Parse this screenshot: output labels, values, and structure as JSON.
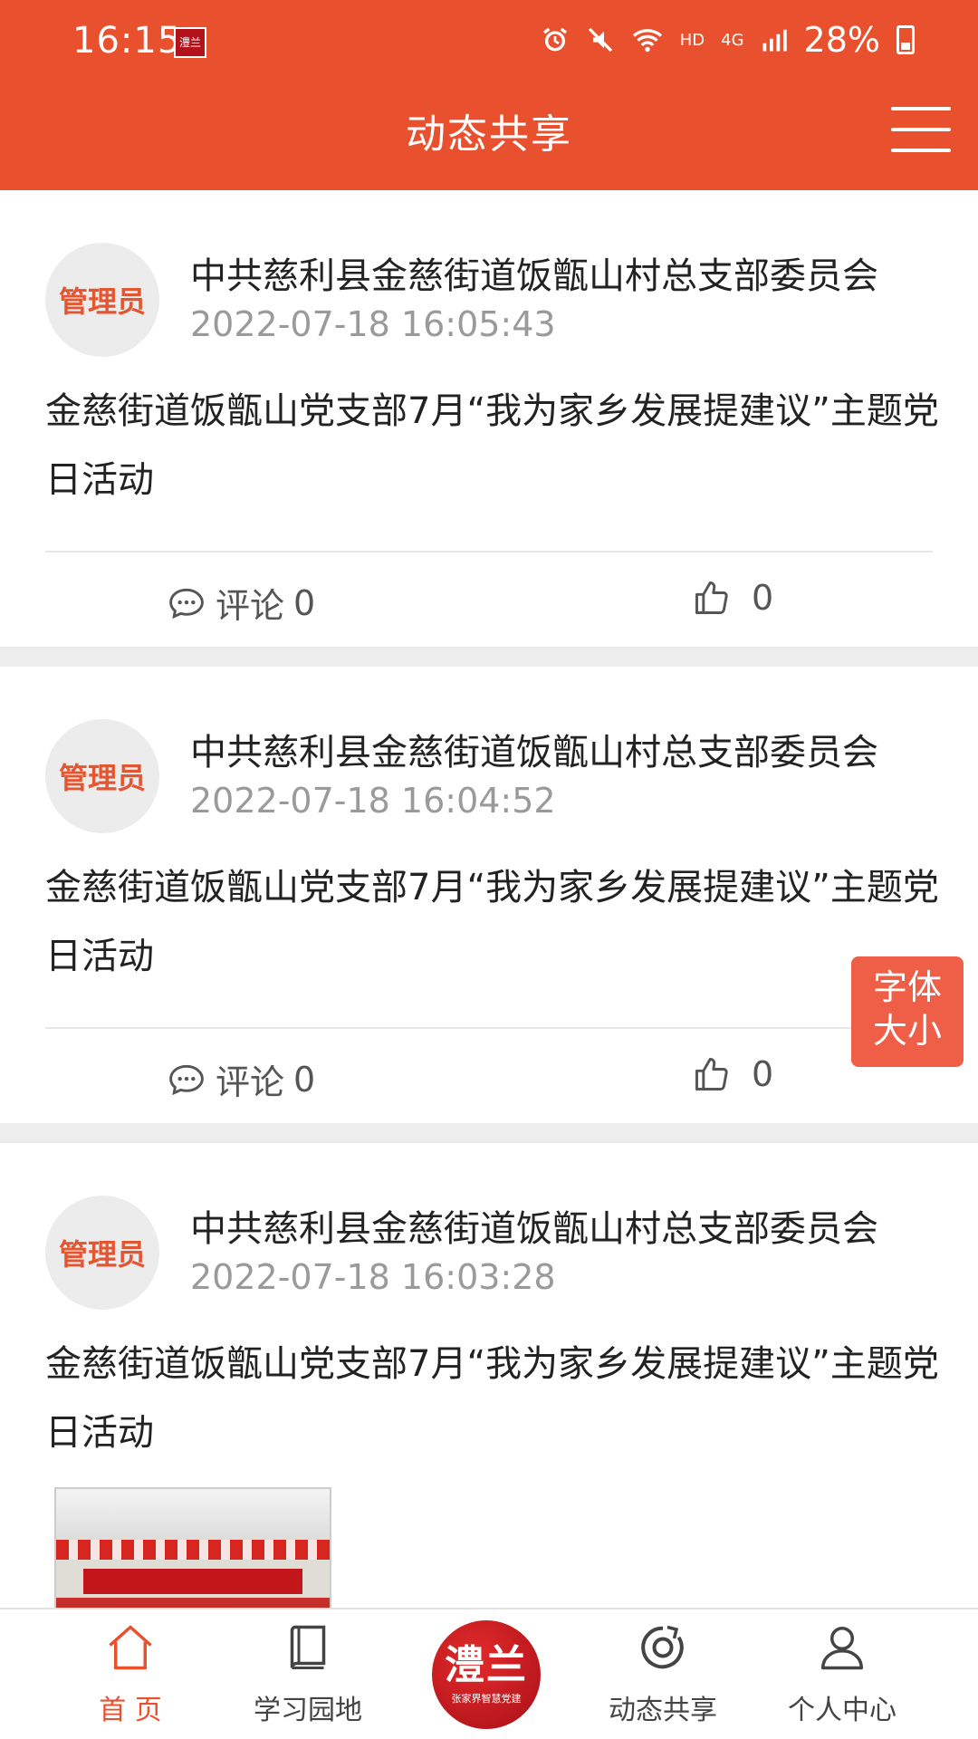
{
  "status_bar": {
    "time": "16:15",
    "app_badge": "澧兰",
    "network": "HD",
    "signal_type": "4G",
    "battery": "28%"
  },
  "header": {
    "title": "动态共享",
    "background_color": "#e9502d"
  },
  "posts": [
    {
      "avatar_label": "管理员",
      "org": "中共慈利县金慈街道饭甑山村总支部委员会",
      "time": "2022-07-18 16:05:43",
      "text": "金慈街道饭甑山党支部7月“我为家乡发展提建议”主题党日活动",
      "comment_label": "评论",
      "comment_count": "0",
      "like_count": "0"
    },
    {
      "avatar_label": "管理员",
      "org": "中共慈利县金慈街道饭甑山村总支部委员会",
      "time": "2022-07-18 16:04:52",
      "text": "金慈街道饭甑山党支部7月“我为家乡发展提建议”主题党日活动",
      "comment_label": "评论",
      "comment_count": "0",
      "like_count": "0"
    },
    {
      "avatar_label": "管理员",
      "org": "中共慈利县金慈街道饭甑山村总支部委员会",
      "time": "2022-07-18 16:03:28",
      "text": "金慈街道饭甑山党支部7月“我为家乡发展提建议”主题党日活动",
      "has_image": true
    }
  ],
  "font_size_button": {
    "line1": "字体",
    "line2": "大小"
  },
  "bottom_nav": {
    "items": [
      {
        "label": "首 页",
        "icon": "home-icon",
        "active": true
      },
      {
        "label": "学习园地",
        "icon": "book-icon"
      },
      {
        "label": "动态共享",
        "icon": "share-icon"
      },
      {
        "label": "个人中心",
        "icon": "user-icon"
      }
    ],
    "center_logo": {
      "title": "澧兰",
      "subtitle": "张家界智慧党建"
    }
  }
}
